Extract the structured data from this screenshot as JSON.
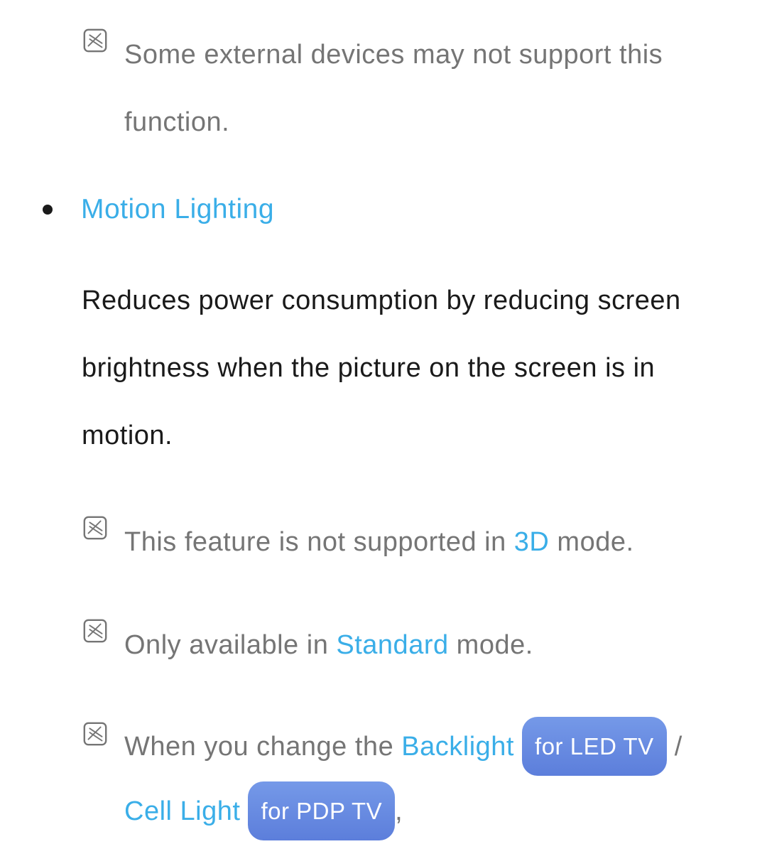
{
  "notes": {
    "note1": "Some external devices may not support this function.",
    "note2_part1": "This feature is not supported in ",
    "note2_highlight": "3D",
    "note2_part2": " mode.",
    "note3_part1": "Only available in ",
    "note3_highlight": "Standard",
    "note3_part2": " mode.",
    "note4_part1": "When you change the ",
    "note4_highlight1": "Backlight",
    "note4_pill1": "for LED TV",
    "note4_separator": " / ",
    "note4_highlight2": "Cell Light",
    "note4_pill2": "for PDP TV",
    "note4_comma": ","
  },
  "heading": "Motion Lighting",
  "description": "Reduces power consumption by reducing screen brightness when the picture on the screen is in motion."
}
